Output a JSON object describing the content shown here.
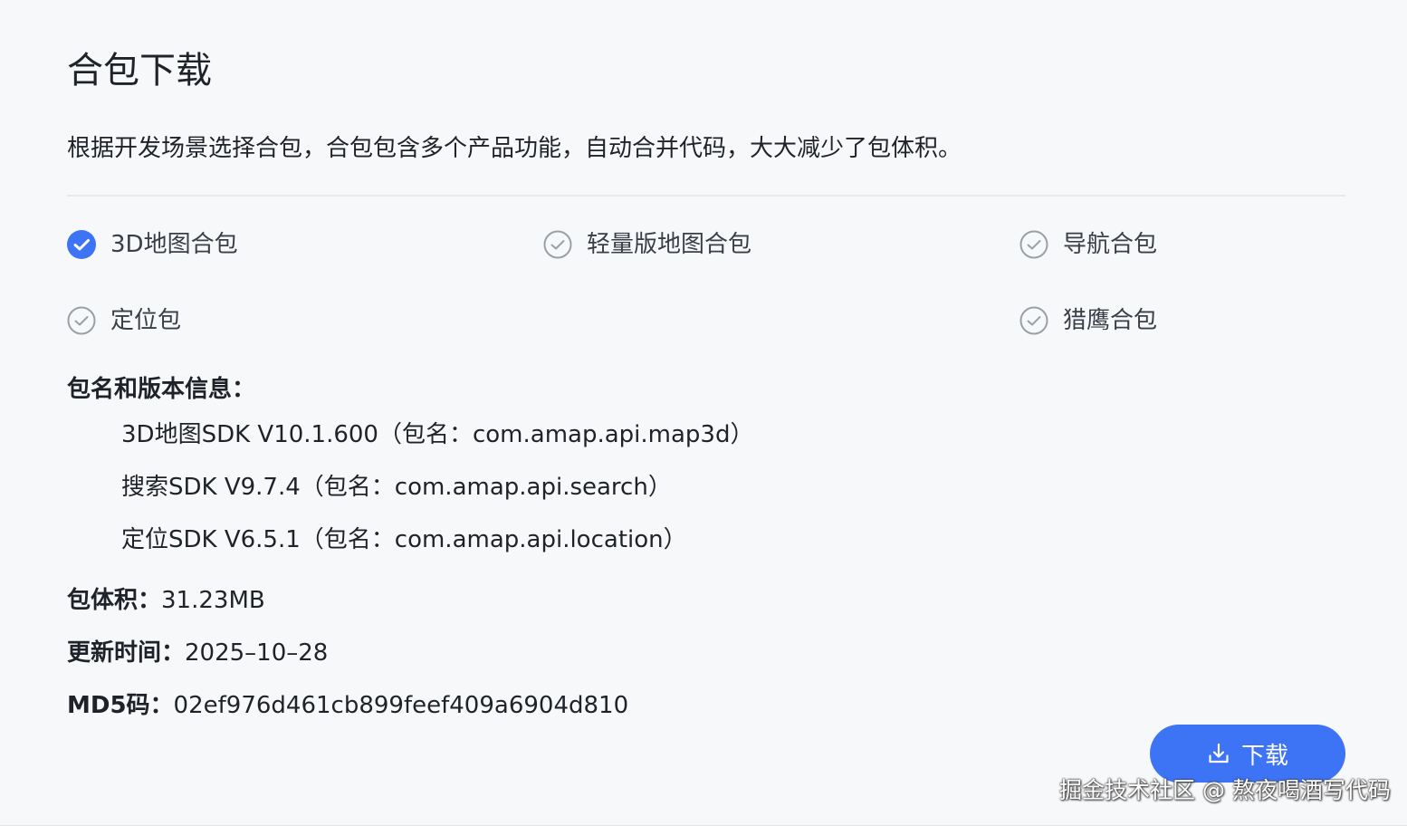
{
  "header": {
    "title": "合包下载",
    "description": "根据开发场景选择合包，合包包含多个产品功能，自动合并代码，大大减少了包体积。"
  },
  "options": [
    {
      "label": "3D地图合包",
      "checked": true
    },
    {
      "label": "轻量版地图合包",
      "checked": false
    },
    {
      "label": "导航合包",
      "checked": false
    },
    {
      "label": "定位包",
      "checked": false
    },
    {
      "label": "猎鹰合包",
      "checked": false
    }
  ],
  "package_info": {
    "label": "包名和版本信息：",
    "items": [
      "3D地图SDK V10.1.600（包名：com.amap.api.map3d）",
      "搜索SDK V9.7.4（包名：com.amap.api.search）",
      "定位SDK V6.5.1（包名：com.amap.api.location）"
    ]
  },
  "size": {
    "label": "包体积：",
    "value": "31.23MB"
  },
  "update_time": {
    "label": "更新时间：",
    "value": "2025–10–28"
  },
  "md5": {
    "label": "MD5码：",
    "value": "02ef976d461cb899feef409a6904d810"
  },
  "download_button": {
    "label": "下载",
    "icon": "download-icon"
  },
  "watermark": "掘金技术社区 @ 熬夜喝酒写代码",
  "colors": {
    "accent": "#3d73f5",
    "unchecked": "#9aa0a8",
    "text": "#1f2329",
    "background": "#f7f8fa"
  }
}
